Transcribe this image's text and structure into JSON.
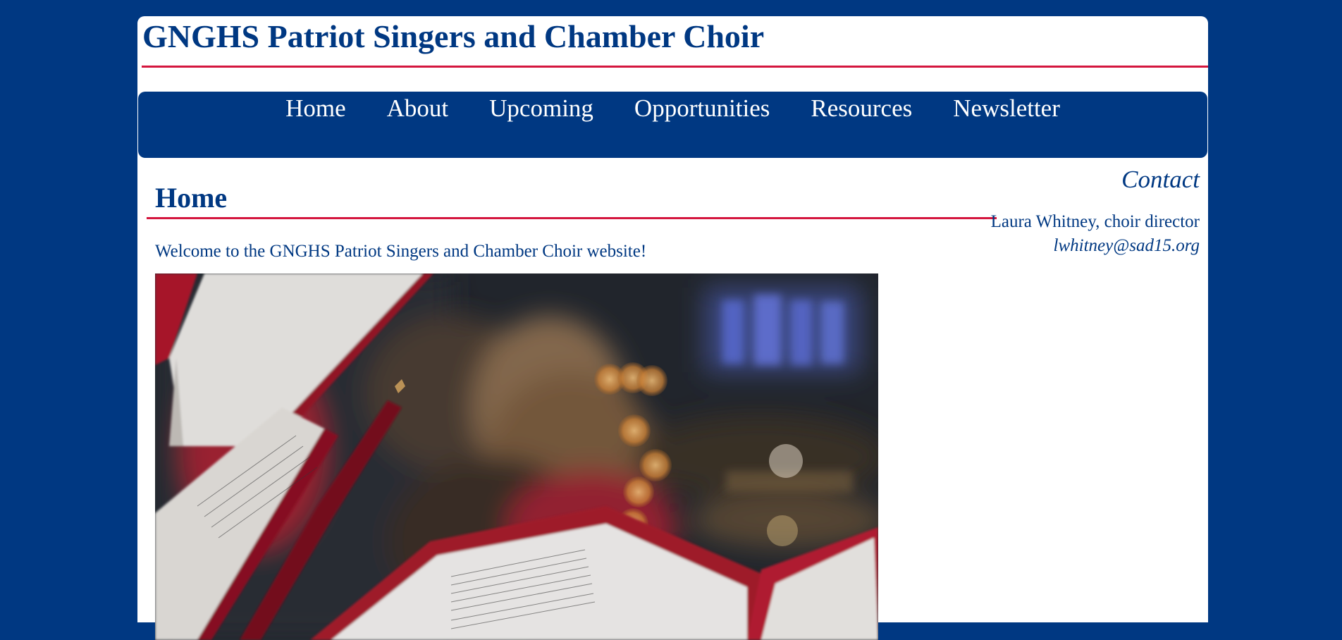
{
  "site": {
    "title": "GNGHS Patriot Singers and Chamber Choir"
  },
  "nav": {
    "items": [
      {
        "label": "Home"
      },
      {
        "label": "About"
      },
      {
        "label": "Upcoming"
      },
      {
        "label": "Opportunities"
      },
      {
        "label": "Resources"
      },
      {
        "label": "Newsletter"
      }
    ]
  },
  "main": {
    "heading": "Home",
    "welcome": "Welcome to the GNGHS Patriot Singers and Chamber Choir website!"
  },
  "contact": {
    "heading": "Contact",
    "name": "Laura Whitney, choir director",
    "email": "lwhitney@sad15.org"
  },
  "colors": {
    "brand_blue": "#003882",
    "accent_red": "#d4163e",
    "background_white": "#ffffff"
  }
}
